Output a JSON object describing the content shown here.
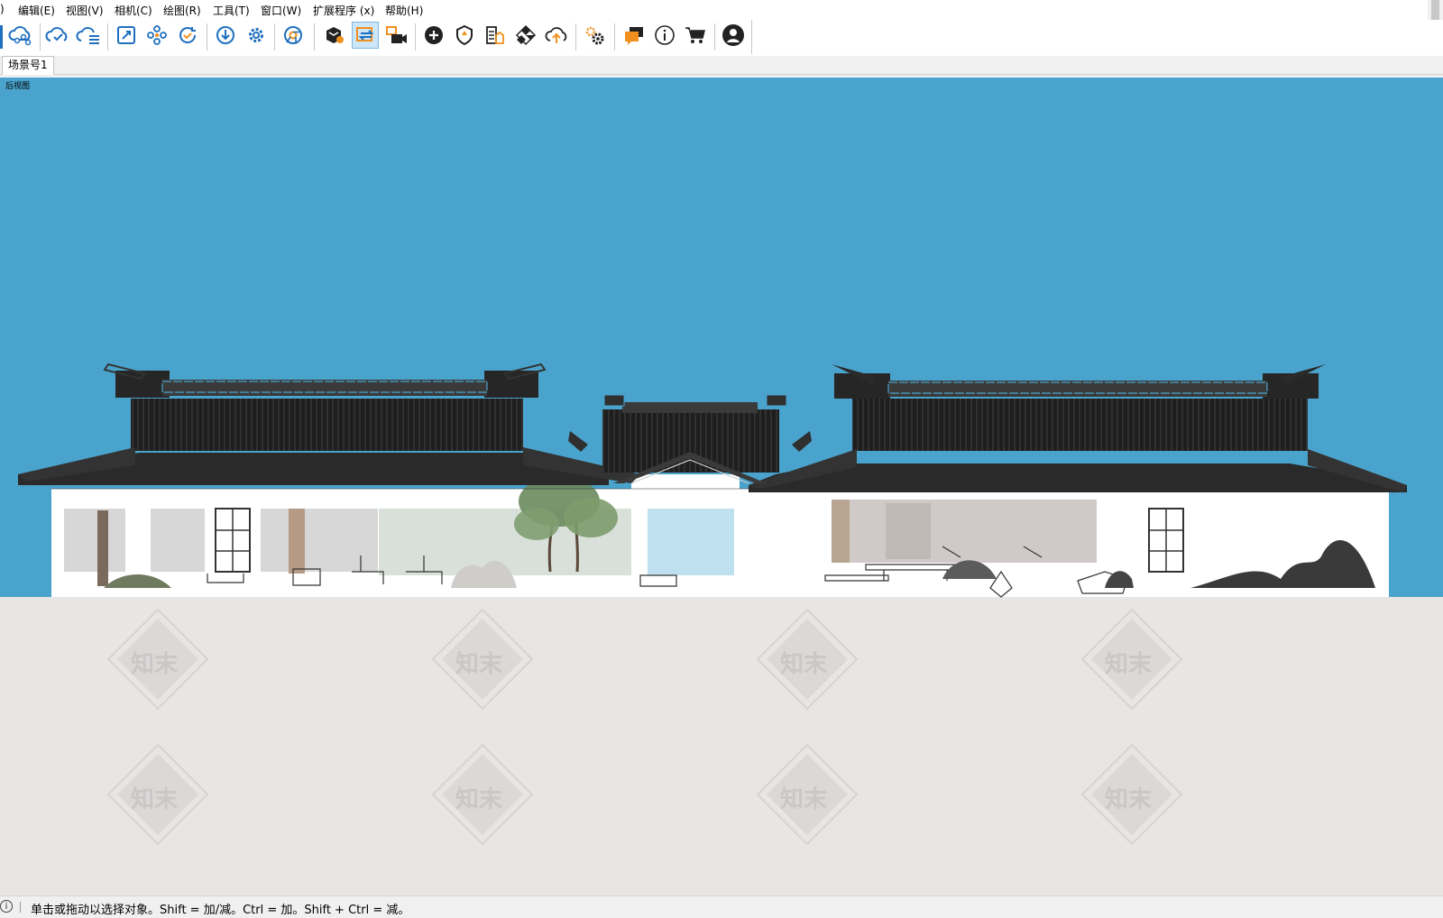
{
  "menu": {
    "items": [
      {
        "label": ")"
      },
      {
        "label": "编辑(E)"
      },
      {
        "label": "视图(V)"
      },
      {
        "label": "相机(C)"
      },
      {
        "label": "绘图(R)"
      },
      {
        "label": "工具(T)"
      },
      {
        "label": "窗口(W)"
      },
      {
        "label": "扩展程序 (x)"
      },
      {
        "label": "帮助(H)"
      }
    ]
  },
  "toolbar": {
    "buttons": [
      {
        "icon": "cloud-share-icon"
      },
      {
        "icon": "cloud-sync-icon"
      },
      {
        "icon": "cloud-list-icon"
      },
      {
        "icon": "frame-select-icon"
      },
      {
        "icon": "molecule-icon"
      },
      {
        "icon": "refresh-check-icon"
      },
      {
        "icon": "download-circle-icon"
      },
      {
        "icon": "gear-icon"
      },
      {
        "icon": "chrome-icon"
      },
      {
        "icon": "box-badge-icon"
      },
      {
        "icon": "swap-arrow-icon"
      },
      {
        "icon": "camera-export-icon"
      },
      {
        "icon": "add-circle-icon"
      },
      {
        "icon": "shield-icon"
      },
      {
        "icon": "document-chart-icon"
      },
      {
        "icon": "checker-icon"
      },
      {
        "icon": "cloud-upload-icon"
      },
      {
        "icon": "settings-gears-icon"
      },
      {
        "icon": "chat-icon"
      },
      {
        "icon": "info-icon"
      },
      {
        "icon": "cart-icon"
      },
      {
        "icon": "account-icon"
      }
    ],
    "active_index": 10,
    "accent": "#1e6fbf",
    "orange": "#f0901e"
  },
  "tabs": [
    {
      "label": "场景号1"
    }
  ],
  "viewport": {
    "view_name": "后视图",
    "sky_color": "#4aa3cc",
    "ground_color": "#e8e6e4",
    "roof_color": "#262626",
    "wall_color": "#ffffff",
    "watermark": "知末"
  },
  "status": {
    "message": "单击或拖动以选择对象。Shift = 加/减。Ctrl = 加。Shift + Ctrl = 减。"
  }
}
